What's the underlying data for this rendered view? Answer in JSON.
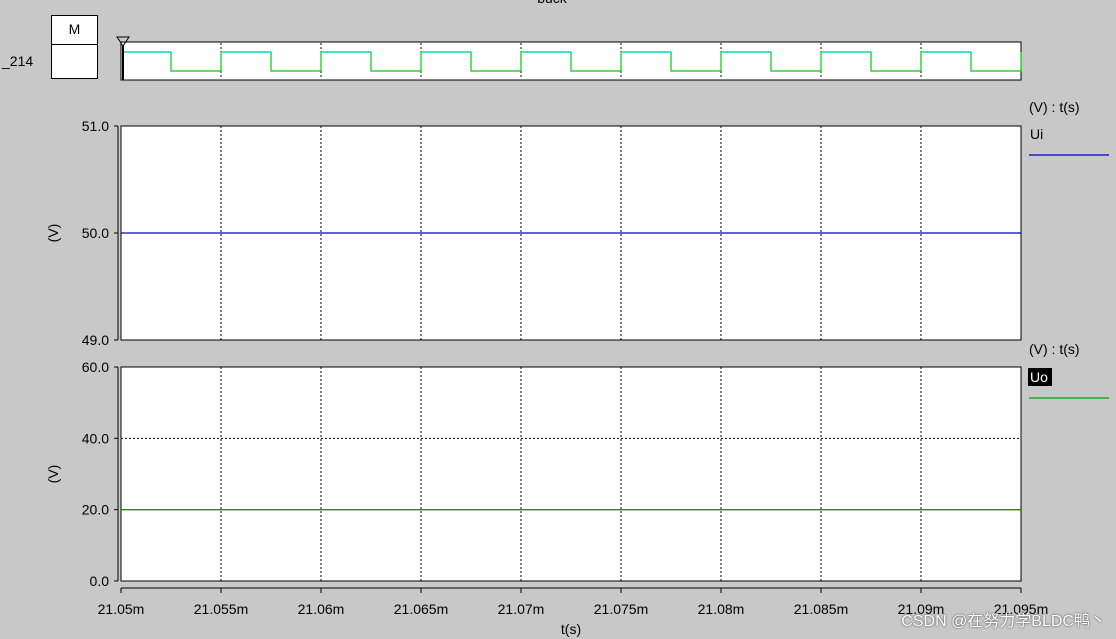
{
  "window": {
    "title_partial": "buck"
  },
  "marker": {
    "label": "M",
    "node": "_214"
  },
  "colors": {
    "ui_line": "#0000cc",
    "uo_line": "#00a000",
    "switch_hi": "#00d8d8",
    "switch_lo": "#00cc00",
    "legend_highlight_bg": "#000000"
  },
  "chart_data": [
    {
      "type": "line",
      "panel": "switch-signal",
      "x_range": [
        21.05,
        21.095
      ],
      "x_unit": "ms",
      "square_wave": {
        "period": 0.005,
        "duty": 0.5,
        "levels": [
          "high",
          "low"
        ]
      }
    },
    {
      "type": "line",
      "panel": "Ui",
      "ylabel": "(V)",
      "legend_header": "(V) : t(s)",
      "series": [
        {
          "name": "Ui",
          "x": [
            21.05,
            21.095
          ],
          "y": [
            50.0,
            50.0
          ],
          "color": "#0000cc"
        }
      ],
      "ylim": [
        49.0,
        51.0
      ],
      "y_ticks": [
        "49.0",
        "50.0",
        "51.0"
      ],
      "x_grid": true,
      "y_grid": false,
      "legend_highlighted": false
    },
    {
      "type": "line",
      "panel": "Uo",
      "ylabel": "(V)",
      "legend_header": "(V) : t(s)",
      "series": [
        {
          "name": "Uo",
          "x": [
            21.05,
            21.095
          ],
          "y": [
            20.0,
            20.0
          ],
          "color": "#00a000"
        }
      ],
      "ylim": [
        0.0,
        60.0
      ],
      "y_ticks": [
        "0.0",
        "20.0",
        "40.0",
        "60.0"
      ],
      "x_grid": true,
      "y_grid": true,
      "legend_highlighted": true
    }
  ],
  "x_axis": {
    "label": "t(s)",
    "ticks": [
      "21.05m",
      "21.055m",
      "21.06m",
      "21.065m",
      "21.07m",
      "21.075m",
      "21.08m",
      "21.085m",
      "21.09m",
      "21.095m"
    ]
  },
  "watermark": "CSDN @在努力学BLDC鸭丶"
}
